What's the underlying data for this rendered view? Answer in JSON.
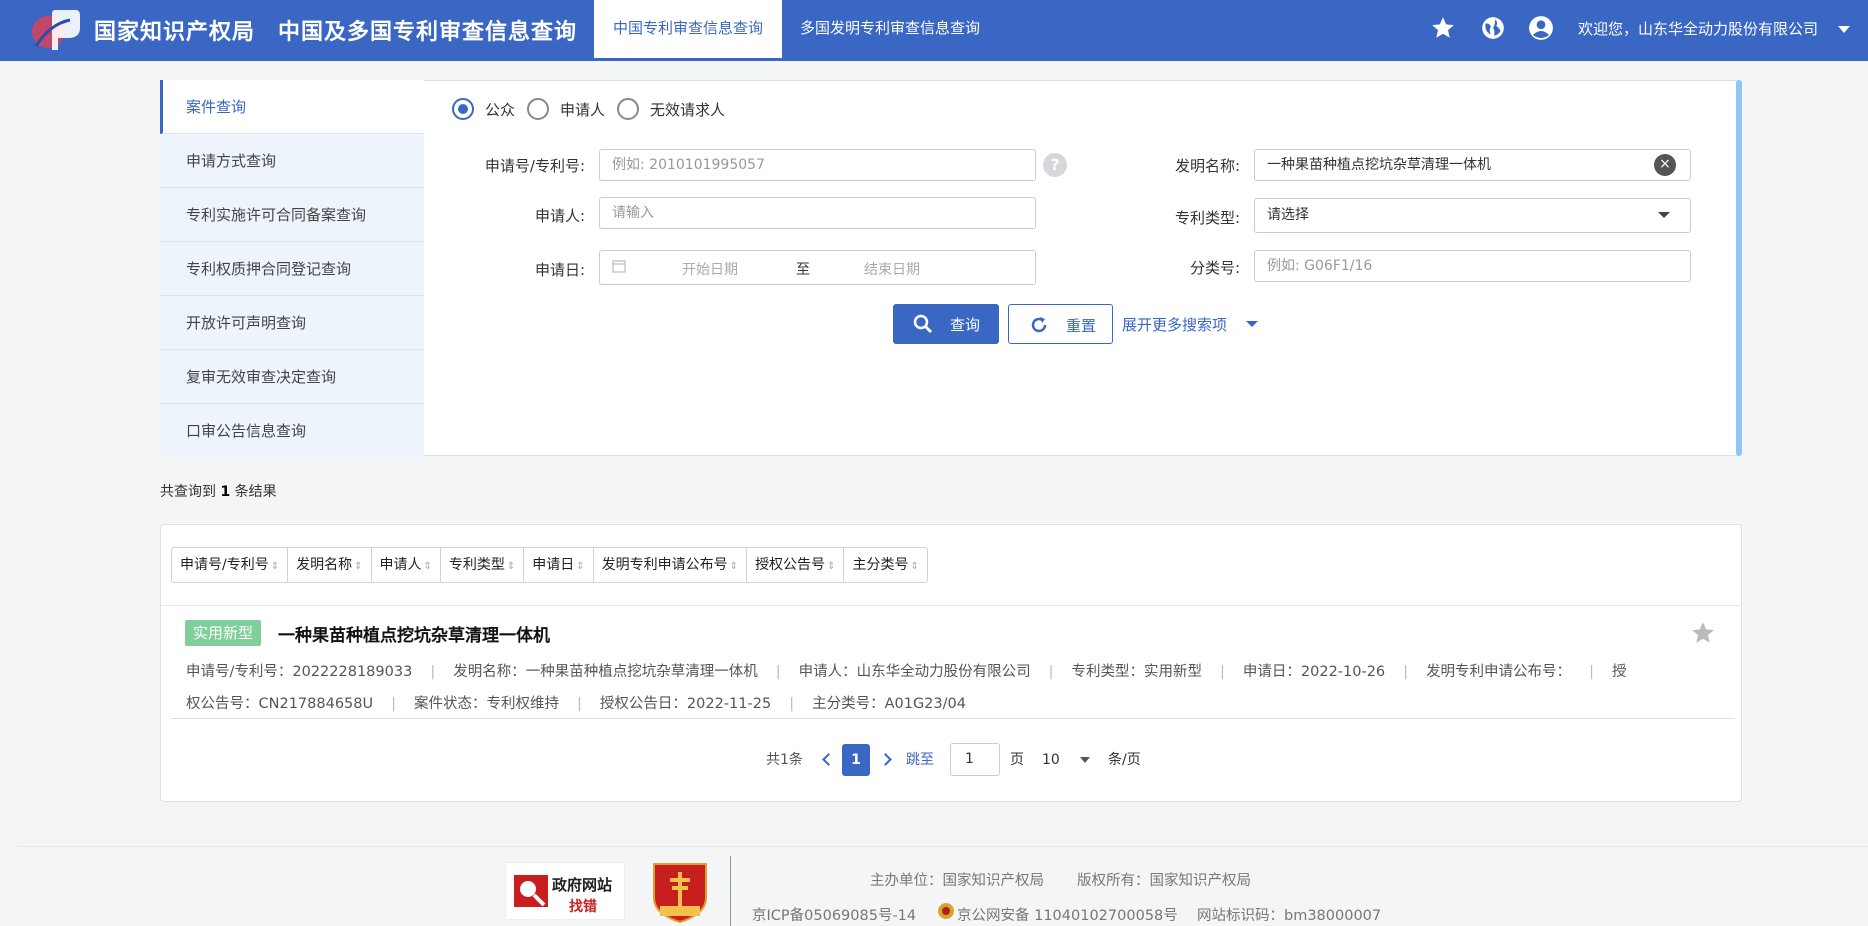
{
  "header": {
    "brand": "国家知识产权局",
    "site_title": "中国及多国专利审查信息查询",
    "tabs": [
      {
        "label": "中国专利审查信息查询",
        "active": true
      },
      {
        "label": "多国发明专利审查信息查询",
        "active": false
      }
    ],
    "welcome": "欢迎您，山东华全动力股份有限公司",
    "icons": [
      "star-icon",
      "globe-icon",
      "user-icon",
      "chevron-down-icon"
    ],
    "bg_color": "#3a66c4"
  },
  "sidenav": {
    "items": [
      {
        "label": "案件查询",
        "active": true
      },
      {
        "label": "申请方式查询",
        "active": false
      },
      {
        "label": "专利实施许可合同备案查询",
        "active": false
      },
      {
        "label": "专利权质押合同登记查询",
        "active": false
      },
      {
        "label": "开放许可声明查询",
        "active": false
      },
      {
        "label": "复审无效审查决定查询",
        "active": false
      },
      {
        "label": "口审公告信息查询",
        "active": false
      }
    ]
  },
  "search": {
    "roles": [
      {
        "label": "公众",
        "checked": true
      },
      {
        "label": "申请人",
        "checked": false
      },
      {
        "label": "无效请求人",
        "checked": false
      }
    ],
    "app_no": {
      "label": "申请号/专利号:",
      "placeholder": "例如: 2010101995057",
      "value": ""
    },
    "applicant": {
      "label": "申请人:",
      "placeholder": "请输入",
      "value": ""
    },
    "app_date": {
      "label": "申请日:",
      "start_placeholder": "开始日期",
      "separator": "至",
      "end_placeholder": "结束日期"
    },
    "invention_name": {
      "label": "发明名称:",
      "value": "一种果苗种植点挖坑杂草清理一体机"
    },
    "patent_type": {
      "label": "专利类型:",
      "value": "请选择"
    },
    "classification": {
      "label": "分类号:",
      "placeholder": "例如: G06F1/16",
      "value": ""
    },
    "search_button": "查询",
    "reset_button": "重置",
    "expand_link": "展开更多搜索项"
  },
  "results": {
    "count_prefix": "共查询到",
    "count": "1",
    "count_suffix": "条结果",
    "sort_columns": [
      "申请号/专利号",
      "发明名称",
      "申请人",
      "专利类型",
      "申请日",
      "发明专利申请公布号",
      "授权公告号",
      "主分类号"
    ],
    "items": [
      {
        "type": "实用新型",
        "title": "一种果苗种植点挖坑杂草清理一体机",
        "row1": [
          "申请号/专利号：2022228189033",
          "发明名称：一种果苗种植点挖坑杂草清理一体机",
          "申请人：山东华全动力股份有限公司",
          "专利类型：实用新型",
          "申请日：2022-10-26",
          "发明专利申请公布号："
        ],
        "row1_tail": "授",
        "row2_head": "权公告号：CN217884658U",
        "row2": [
          "案件状态：专利权维持",
          "授权公告日：2022-11-25",
          "主分类号：A01G23/04"
        ]
      }
    ]
  },
  "pagination": {
    "total": "共1条",
    "current_page": "1",
    "jump_label": "跳至",
    "jump_value": "1",
    "page_unit": "页",
    "page_size": "10",
    "size_unit": "条/页"
  },
  "footer": {
    "gov_badge_line1": "政府网站",
    "gov_badge_line2": "找错",
    "sponsor": "主办单位：国家知识产权局",
    "copyright": "版权所有：国家知识产权局",
    "icp": "京ICP备05069085号-14",
    "police": "京公网安备 11040102700058号",
    "site_code": "网站标识码：bm38000007"
  }
}
